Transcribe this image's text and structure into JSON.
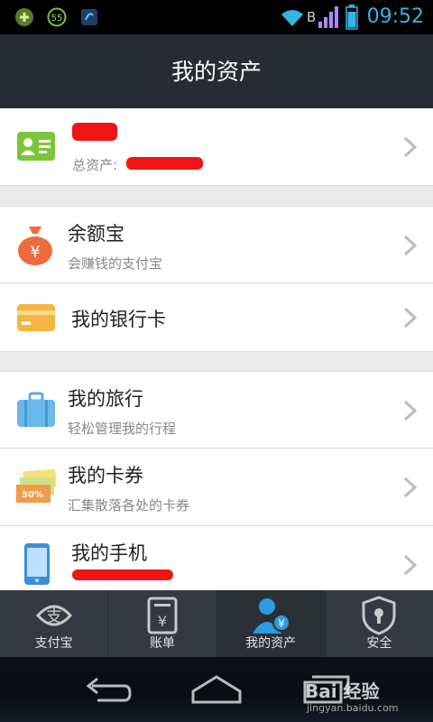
{
  "status_bar": {
    "time": "09:52",
    "network_letter": "B",
    "icons": [
      "notification-app-icon",
      "timer-55-icon",
      "sync-icon",
      "wifi-icon",
      "signal-icon",
      "battery-icon"
    ],
    "timer_value": "55"
  },
  "header": {
    "title": "我的资产"
  },
  "account": {
    "total_assets_label": "总资产:",
    "icon": "id-card-icon"
  },
  "items": [
    {
      "title": "余额宝",
      "subtitle": "会赚钱的支付宝",
      "icon": "money-bag-icon"
    },
    {
      "title": "我的银行卡",
      "subtitle": "",
      "icon": "bank-card-icon"
    },
    {
      "title": "我的旅行",
      "subtitle": "轻松管理我的行程",
      "icon": "suitcase-icon"
    },
    {
      "title": "我的卡券",
      "subtitle": "汇集散落各处的卡券",
      "icon": "coupon-icon",
      "badge": "50%"
    },
    {
      "title": "我的手机",
      "subtitle": "",
      "icon": "phone-icon"
    }
  ],
  "tabs": [
    {
      "label": "支付宝",
      "icon": "alipay-icon",
      "glyph": "支",
      "active": false
    },
    {
      "label": "账单",
      "icon": "bill-icon",
      "glyph": "¥",
      "active": false
    },
    {
      "label": "我的资产",
      "icon": "user-assets-icon",
      "glyph": "¥",
      "active": true
    },
    {
      "label": "安全",
      "icon": "shield-lock-icon",
      "active": false
    }
  ],
  "watermark": {
    "text": "Bai 经验",
    "url": "jingyan.baidu.com"
  },
  "colors": {
    "header_bg": "#272b33",
    "accent_blue": "#2d9be0",
    "status_time": "#33b5e5",
    "redaction": "#f01414"
  }
}
